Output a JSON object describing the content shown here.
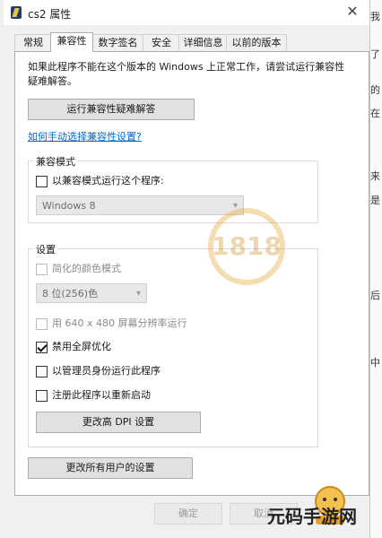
{
  "window": {
    "title": "cs2 属性"
  },
  "tabs": [
    "常规",
    "兼容性",
    "数字签名",
    "安全",
    "详细信息",
    "以前的版本"
  ],
  "active_tab": "兼容性",
  "intro": "如果此程序不能在这个版本的 Windows 上正常工作，请尝试运行兼容性疑难解答。",
  "run_troubleshooter": "运行兼容性疑难解答",
  "manual_link": "如何手动选择兼容性设置?",
  "compat_mode": {
    "group_label": "兼容模式",
    "checkbox": {
      "label": "以兼容模式运行这个程序:",
      "checked": false
    },
    "select_value": "Windows 8"
  },
  "settings": {
    "group_label": "设置",
    "reduced_color": {
      "label": "简化的颜色模式",
      "checked": false,
      "enabled": false
    },
    "color_select": "8 位(256)色",
    "res640": {
      "label": "用 640 x 480 屏幕分辨率运行",
      "checked": false,
      "enabled": false
    },
    "disable_fullscreen": {
      "label": "禁用全屏优化",
      "checked": true
    },
    "run_as_admin": {
      "label": "以管理员身份运行此程序",
      "checked": false
    },
    "register_restart": {
      "label": "注册此程序以重新启动",
      "checked": false
    },
    "dpi_button": "更改高 DPI 设置"
  },
  "all_users_button": "更改所有用户的设置",
  "footer": {
    "ok": "确定",
    "cancel": "取消"
  },
  "watermark": {
    "brand": "元码手游网",
    "logo_text": "1818"
  },
  "background_fragments": [
    "我",
    "了",
    "的",
    "在",
    "来",
    "是",
    "后",
    "中"
  ]
}
